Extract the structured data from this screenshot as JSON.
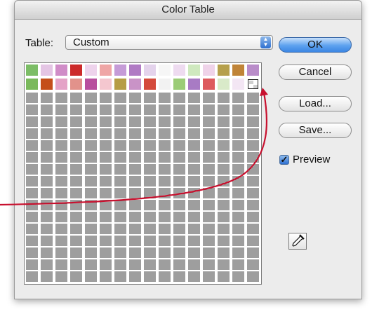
{
  "window": {
    "title": "Color Table"
  },
  "table": {
    "label": "Table:",
    "value": "Custom"
  },
  "buttons": {
    "ok": "OK",
    "cancel": "Cancel",
    "load": "Load...",
    "save": "Save..."
  },
  "preview": {
    "label": "Preview",
    "checked": true
  },
  "swatch_colors": [
    [
      "#7cbd66",
      "#e4c5e4",
      "#d08cc7",
      "#cc2a2a",
      "#eed3ec",
      "#efa6a6",
      "#c59bd7",
      "#b07ac4",
      "#e4d3ec",
      "#f6f6f6",
      "#eedbf0",
      "#cfe9bf",
      "#efd3e9",
      "#b6a04c",
      "#c08438",
      "#b98cc9"
    ],
    [
      "#7ab95c",
      "#c44e1a",
      "#e4a3c7",
      "#e2928b",
      "#b84f9e",
      "#f4c7cf",
      "#b69d44",
      "#c993c7",
      "#d44a3c",
      "#f2f2f2",
      "#9bcc77",
      "#a87bc4",
      "#dd5a5e",
      "#d9eac9",
      "#f3e6f4",
      "selected"
    ]
  ],
  "icons": {
    "select_arrows": "up-down-arrows-icon",
    "eyedropper": "eyedropper-icon",
    "preview_check": "checkmark-icon"
  },
  "accent_color": "#c8102e"
}
